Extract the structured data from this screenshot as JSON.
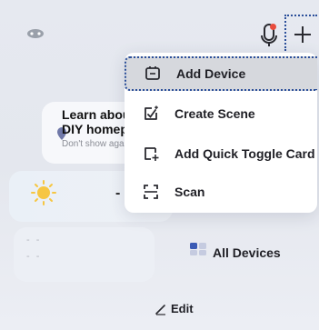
{
  "learn_card": {
    "title_line1": "Learn abou",
    "title_line2": "DIY homep",
    "subtitle": "Don't show agai"
  },
  "weather_card": {
    "value": "-",
    "icon": "sun-icon"
  },
  "empty_card": {
    "line1": "- -",
    "line2": "- -"
  },
  "all_devices": {
    "label": "All Devices",
    "icon": "devices-grid-icon"
  },
  "edit": {
    "label": "Edit",
    "icon": "pencil-icon"
  },
  "menu": {
    "items": [
      {
        "label": "Add Device",
        "icon": "add-device-icon"
      },
      {
        "label": "Create Scene",
        "icon": "create-scene-icon"
      },
      {
        "label": "Add Quick Toggle Card",
        "icon": "add-card-icon"
      },
      {
        "label": "Scan",
        "icon": "scan-icon"
      }
    ]
  },
  "colors": {
    "accent": "#2b4f9a",
    "notification": "#e84c3d",
    "highlight": "#d6d8dd"
  }
}
